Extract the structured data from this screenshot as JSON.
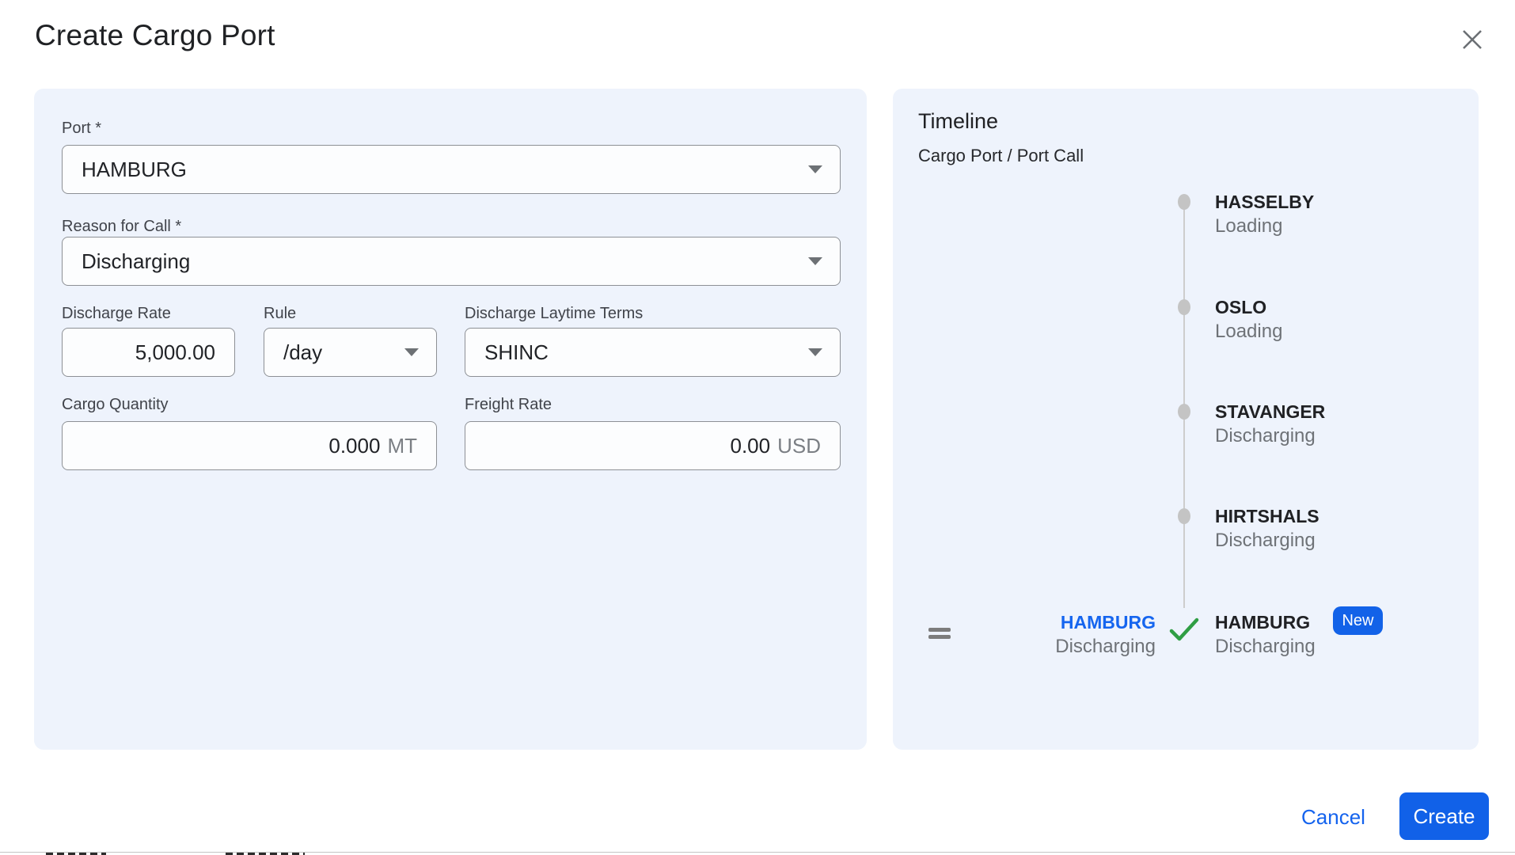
{
  "header": {
    "title": "Create Cargo Port"
  },
  "form": {
    "port": {
      "label": "Port *",
      "value": "HAMBURG"
    },
    "reason_for_call": {
      "label": "Reason for Call *",
      "value": "Discharging"
    },
    "discharge_rate": {
      "label": "Discharge Rate",
      "value": "5,000.00"
    },
    "rule": {
      "label": "Rule",
      "value": "/day"
    },
    "discharge_laytime_terms": {
      "label": "Discharge Laytime Terms",
      "value": "SHINC"
    },
    "cargo_quantity": {
      "label": "Cargo Quantity",
      "value": "0.000",
      "unit": "MT"
    },
    "freight_rate": {
      "label": "Freight Rate",
      "value": "0.00",
      "unit": "USD"
    }
  },
  "timeline": {
    "title": "Timeline",
    "subtitle": "Cargo Port / Port Call",
    "items": [
      {
        "port": "HASSELBY",
        "status": "Loading"
      },
      {
        "port": "OSLO",
        "status": "Loading"
      },
      {
        "port": "STAVANGER",
        "status": "Discharging"
      },
      {
        "port": "HIRTSHALS",
        "status": "Discharging"
      }
    ],
    "new_item": {
      "badge": "New",
      "cargo_port": {
        "port": "HAMBURG",
        "status": "Discharging"
      },
      "port_call": {
        "port": "HAMBURG",
        "status": "Discharging"
      }
    }
  },
  "footer": {
    "cancel_label": "Cancel",
    "create_label": "Create"
  },
  "colors": {
    "accent_blue": "#1262e8",
    "link_blue": "#1565ef",
    "check_green": "#2f9e44",
    "panel_bg": "#eef3fc"
  }
}
